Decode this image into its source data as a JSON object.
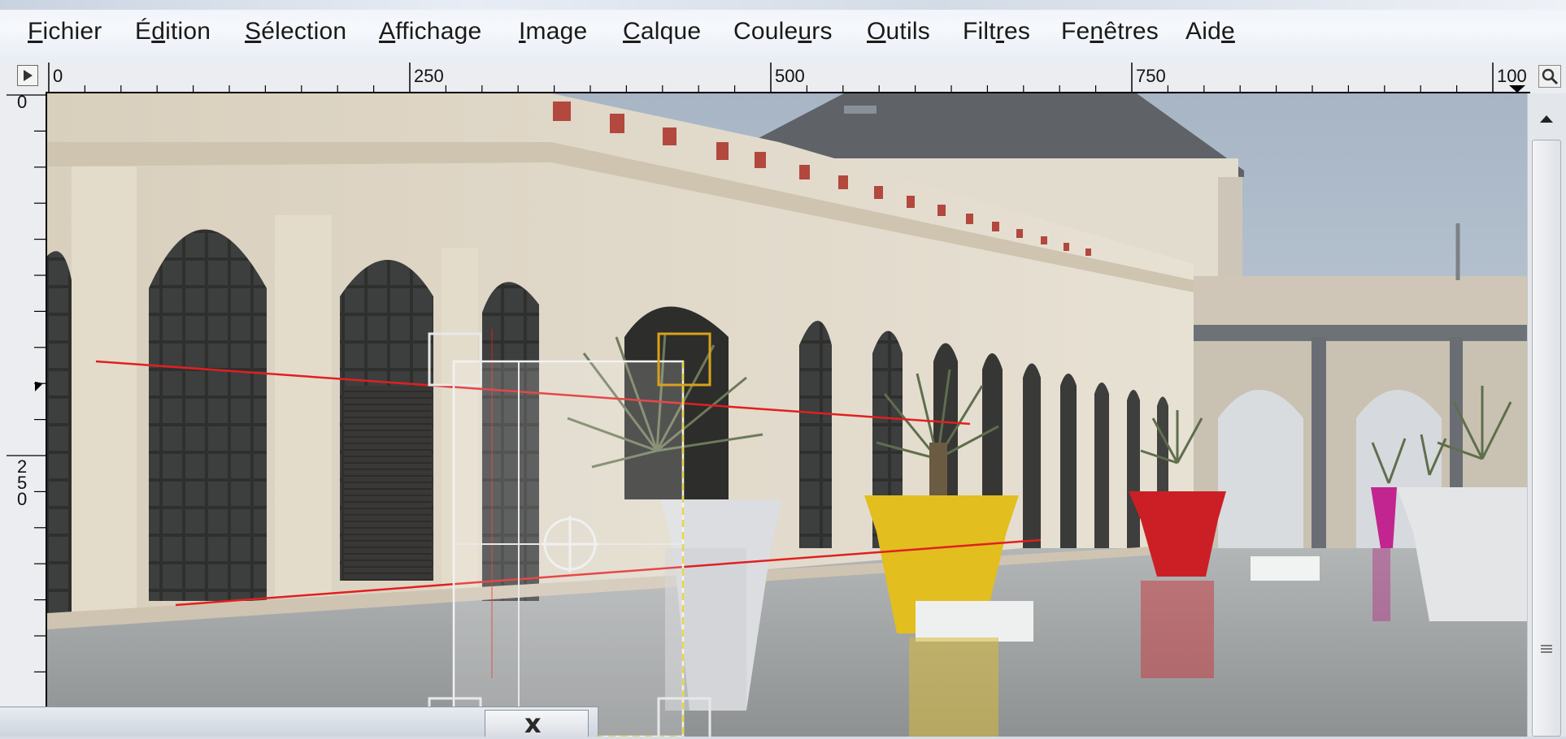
{
  "menubar": {
    "items": [
      {
        "pre": "",
        "key": "F",
        "post": "ichier"
      },
      {
        "pre": "É",
        "key": "d",
        "post": "ition"
      },
      {
        "pre": "",
        "key": "S",
        "post": "élection"
      },
      {
        "pre": "",
        "key": "A",
        "post": "ffichage"
      },
      {
        "pre": "",
        "key": "I",
        "post": "mage"
      },
      {
        "pre": "",
        "key": "C",
        "post": "alque"
      },
      {
        "pre": "Coule",
        "key": "u",
        "post": "rs"
      },
      {
        "pre": "",
        "key": "O",
        "post": "utils"
      },
      {
        "pre": "Filt",
        "key": "r",
        "post": "es"
      },
      {
        "pre": "Fe",
        "key": "n",
        "post": "êtres"
      },
      {
        "pre": "Aid",
        "key": "e",
        "post": ""
      }
    ]
  },
  "rulers": {
    "horizontal_labels": [
      "0",
      "250",
      "500",
      "750",
      "100"
    ],
    "vertical_labels": [
      "0",
      "2",
      "5",
      "0"
    ]
  },
  "dialog": {
    "close_label": "x"
  },
  "colors": {
    "menubar_bg": "#eef3fa",
    "guide_red": "#e02020",
    "handle_orange": "#d9a21a",
    "pot_yellow": "#e2be1e",
    "pot_red": "#cc1f25",
    "pot_magenta": "#c2258f"
  },
  "icons": {
    "ruler_nav": "play-triangle-icon",
    "zoom": "zoom-magnifier-icon",
    "scroll_up": "chevron-up-icon",
    "scroll_grip": "grip-lines-icon",
    "dialog_close": "close-icon"
  }
}
